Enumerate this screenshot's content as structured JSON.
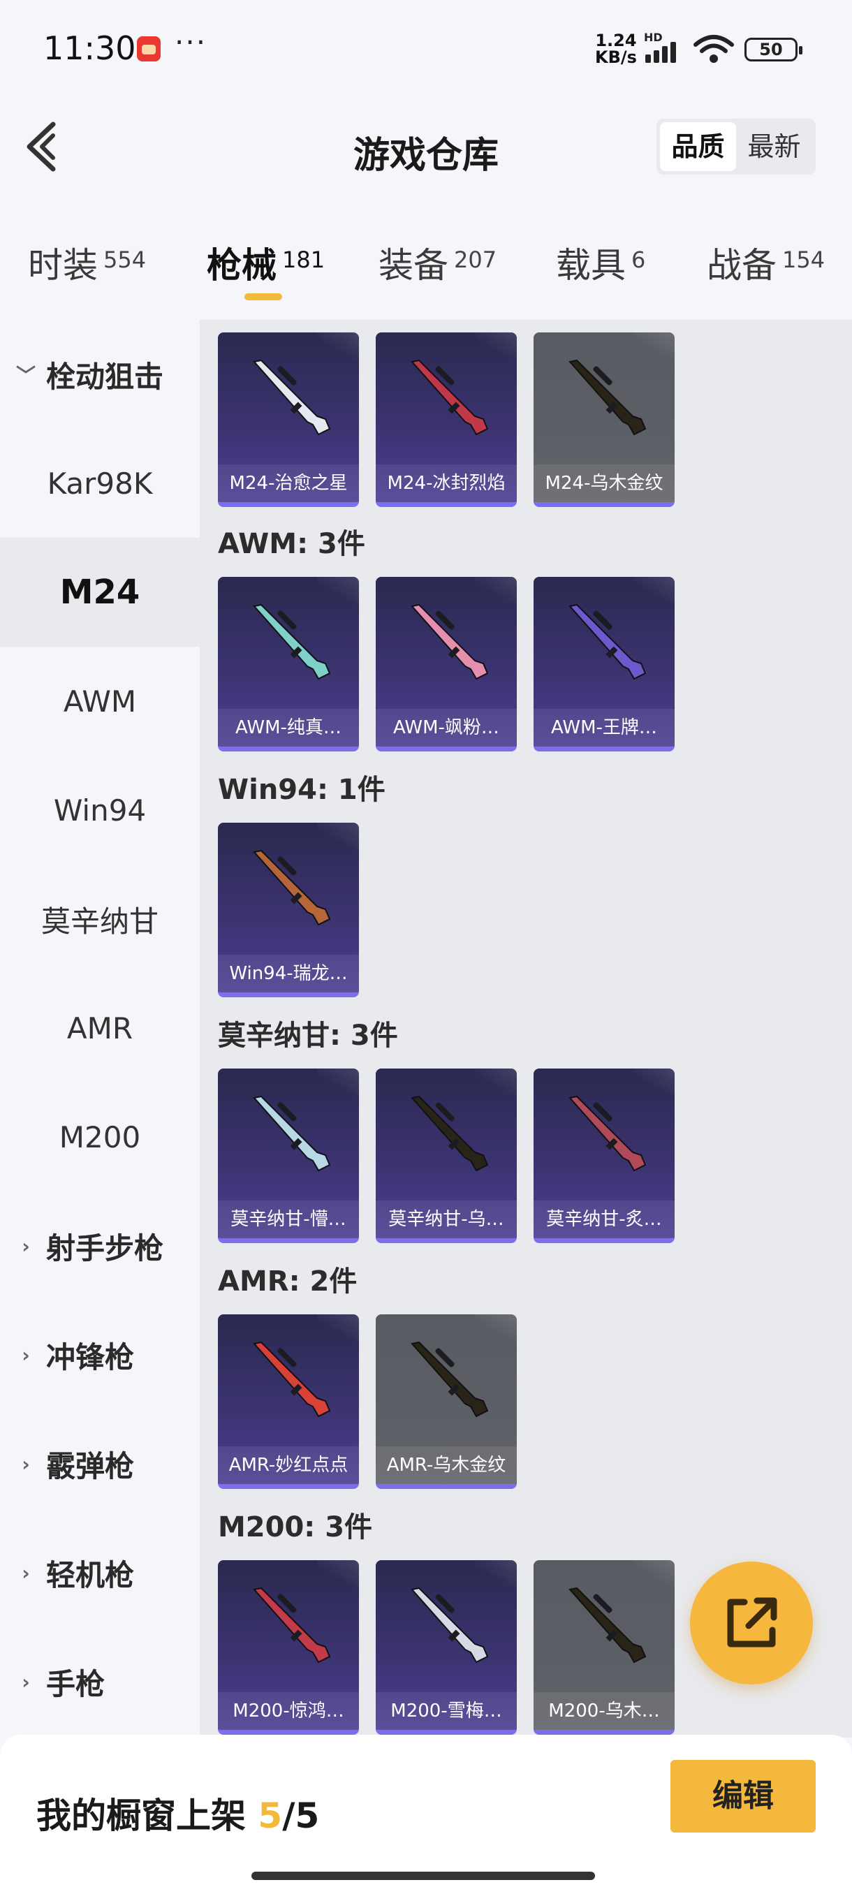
{
  "status_bar": {
    "time": "11:30",
    "net_speed_value": "1.24",
    "net_speed_unit": "KB/s",
    "hd_badge": "HD",
    "battery": "50",
    "more": "···",
    "icons": [
      "app-notification-icon",
      "signal-icon",
      "wifi-icon",
      "battery-icon"
    ]
  },
  "header": {
    "title": "游戏仓库",
    "sort_options": [
      "品质",
      "最新"
    ],
    "sort_selected": "品质"
  },
  "category_tabs": [
    {
      "label": "时装",
      "count": "554"
    },
    {
      "label": "枪械",
      "count": "181",
      "active": true
    },
    {
      "label": "装备",
      "count": "207"
    },
    {
      "label": "载具",
      "count": "6"
    },
    {
      "label": "战备",
      "count": "154"
    }
  ],
  "sidebar": [
    {
      "label": "栓动狙击",
      "type": "group",
      "expanded": true
    },
    {
      "label": "Kar98K",
      "type": "item"
    },
    {
      "label": "M24",
      "type": "item",
      "selected": true
    },
    {
      "label": "AWM",
      "type": "item"
    },
    {
      "label": "Win94",
      "type": "item"
    },
    {
      "label": "莫辛纳甘",
      "type": "item"
    },
    {
      "label": "AMR",
      "type": "item"
    },
    {
      "label": "M200",
      "type": "item"
    },
    {
      "label": "射手步枪",
      "type": "group",
      "expanded": false
    },
    {
      "label": "冲锋枪",
      "type": "group",
      "expanded": false
    },
    {
      "label": "霰弹枪",
      "type": "group",
      "expanded": false
    },
    {
      "label": "轻机枪",
      "type": "group",
      "expanded": false
    },
    {
      "label": "手枪",
      "type": "group",
      "expanded": false
    }
  ],
  "sections": [
    {
      "title": "",
      "items": [
        {
          "name": "M24-治愈之星",
          "style": "purple",
          "gun_color": "#e6e8ef"
        },
        {
          "name": "M24-冰封烈焰",
          "style": "purple",
          "gun_color": "#c0394a"
        },
        {
          "name": "M24-乌木金纹",
          "style": "gray",
          "gun_color": "#2a2418"
        }
      ]
    },
    {
      "title": "AWM: 3件",
      "items": [
        {
          "name": "AWM-纯真…",
          "style": "purple",
          "gun_color": "#7fd0c8"
        },
        {
          "name": "AWM-飒粉…",
          "style": "purple",
          "gun_color": "#e58fb0"
        },
        {
          "name": "AWM-王牌…",
          "style": "purple",
          "gun_color": "#6a5acd"
        }
      ]
    },
    {
      "title": "Win94: 1件",
      "items": [
        {
          "name": "Win94-瑞龙…",
          "style": "purple",
          "gun_color": "#b5663a"
        }
      ]
    },
    {
      "title": "莫辛纳甘: 3件",
      "items": [
        {
          "name": "莫辛纳甘-懵…",
          "style": "purple",
          "gun_color": "#b9d8e6"
        },
        {
          "name": "莫辛纳甘-乌…",
          "style": "purple",
          "gun_color": "#2a2418"
        },
        {
          "name": "莫辛纳甘-炙…",
          "style": "purple",
          "gun_color": "#b04a5a"
        }
      ]
    },
    {
      "title": "AMR: 2件",
      "items": [
        {
          "name": "AMR-妙红点点",
          "style": "purple",
          "gun_color": "#d8423a"
        },
        {
          "name": "AMR-乌木金纹",
          "style": "gray",
          "gun_color": "#2a2418"
        }
      ]
    },
    {
      "title": "M200: 3件",
      "items": [
        {
          "name": "M200-惊鸿…",
          "style": "purple",
          "gun_color": "#c23b4a"
        },
        {
          "name": "M200-雪梅…",
          "style": "purple",
          "gun_color": "#d6dae4"
        },
        {
          "name": "M200-乌木…",
          "style": "gray",
          "gun_color": "#2a2418"
        }
      ]
    }
  ],
  "bottom_bar": {
    "label": "我的橱窗上架",
    "current": "5",
    "total": "/5",
    "edit_label": "编辑"
  },
  "colors": {
    "accent": "#f2b93b",
    "card_purple": "#3b3370",
    "card_gray": "#5d5f66",
    "card_underline": "#7b6ff0"
  },
  "fab_icon": "share-icon"
}
